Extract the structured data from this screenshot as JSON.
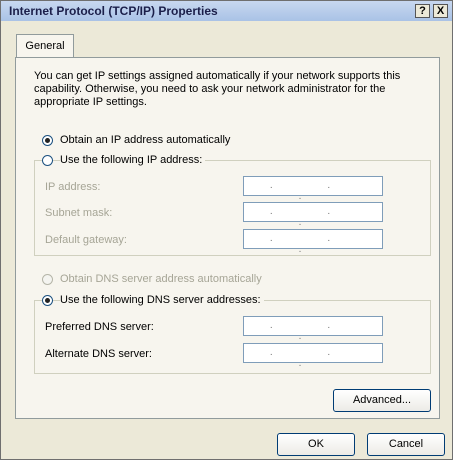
{
  "window": {
    "title": "Internet Protocol (TCP/IP) Properties",
    "help_label": "?",
    "close_label": "X"
  },
  "tabs": [
    {
      "label": "General"
    }
  ],
  "general": {
    "description": "You can get IP settings assigned automatically if your network supports this capability. Otherwise, you need to ask your network administrator for the appropriate IP settings.",
    "ip": {
      "auto_label": "Obtain an IP address automatically",
      "manual_label": "Use the following IP address:",
      "selected": "auto",
      "fields": [
        {
          "label": "IP address:",
          "value": ". . ."
        },
        {
          "label": "Subnet mask:",
          "value": ". . ."
        },
        {
          "label": "Default gateway:",
          "value": ". . ."
        }
      ]
    },
    "dns": {
      "auto_label": "Obtain DNS server address automatically",
      "manual_label": "Use the following DNS server addresses:",
      "selected": "manual",
      "fields": [
        {
          "label": "Preferred DNS server:",
          "value": ". . ."
        },
        {
          "label": "Alternate DNS server:",
          "value": ". . ."
        }
      ]
    },
    "advanced_label": "Advanced..."
  },
  "footer": {
    "ok_label": "OK",
    "cancel_label": "Cancel"
  }
}
